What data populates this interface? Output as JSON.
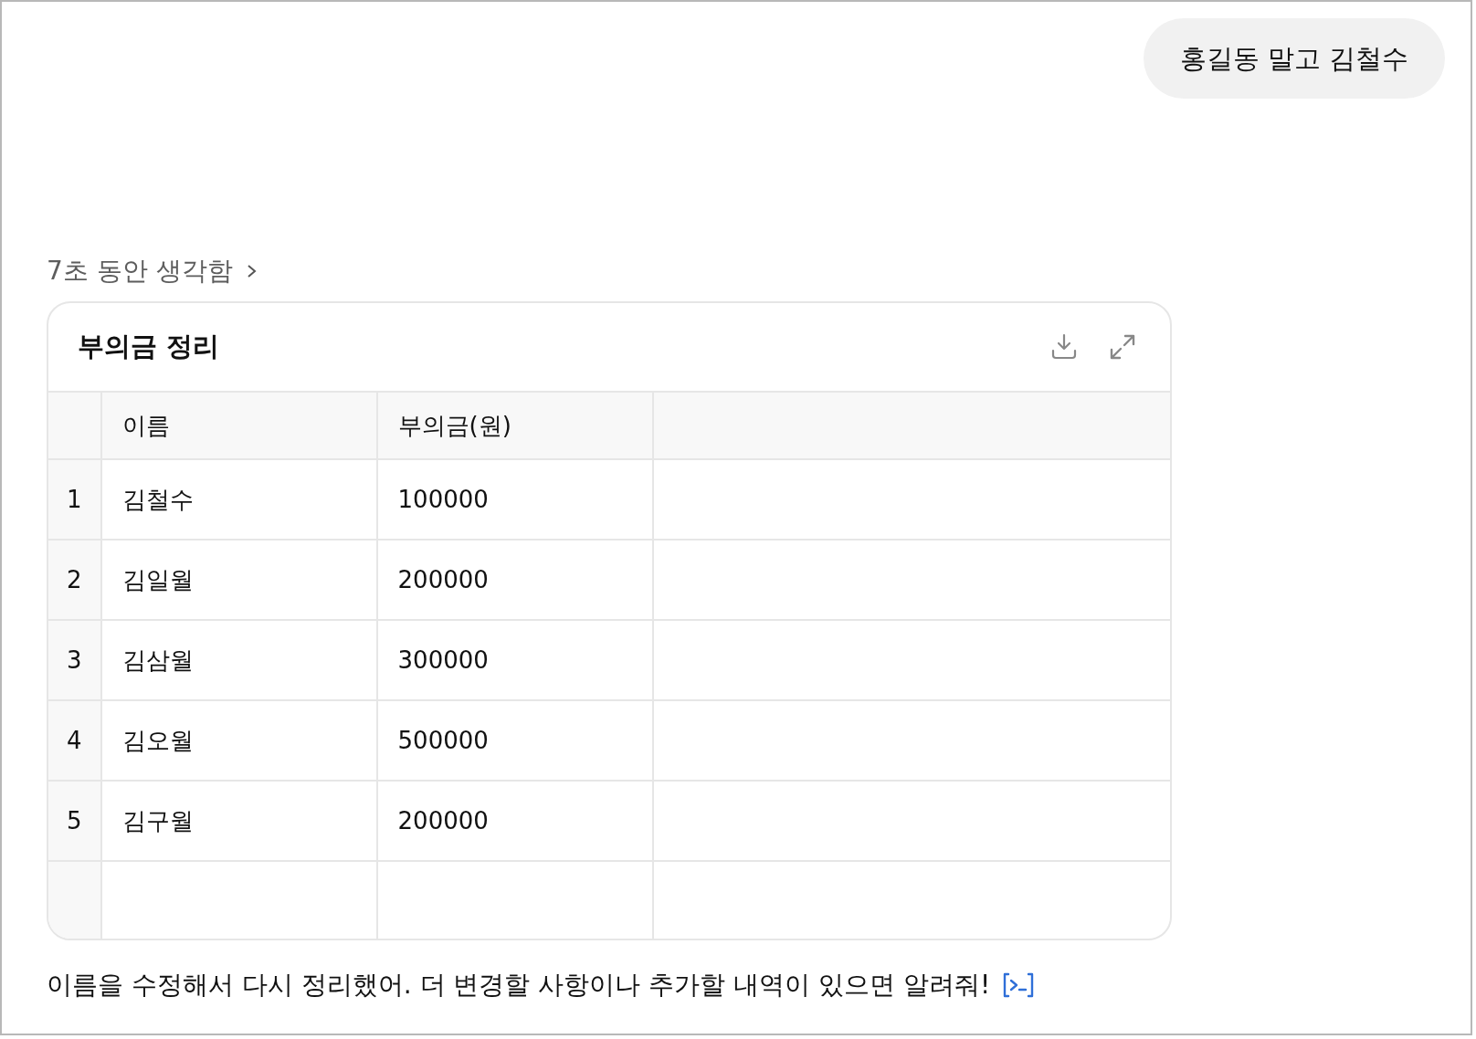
{
  "user_message": "홍길동 말고 김철수",
  "thinking": {
    "label": "7초 동안 생각함"
  },
  "table_card": {
    "title": "부의금 정리",
    "columns": [
      "이름",
      "부의금(원)"
    ],
    "rows": [
      {
        "index": "1",
        "cells": [
          "김철수",
          "100000"
        ]
      },
      {
        "index": "2",
        "cells": [
          "김일월",
          "200000"
        ]
      },
      {
        "index": "3",
        "cells": [
          "김삼월",
          "300000"
        ]
      },
      {
        "index": "4",
        "cells": [
          "김오월",
          "500000"
        ]
      },
      {
        "index": "5",
        "cells": [
          "김구월",
          "200000"
        ]
      }
    ]
  },
  "reply": "이름을 수정해서 다시 정리했어. 더 변경할 사항이나 추가할 내역이 있으면 알려줘!"
}
